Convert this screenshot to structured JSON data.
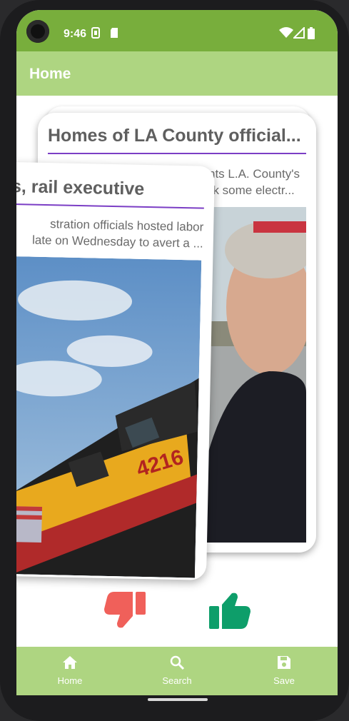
{
  "statusbar": {
    "time": "9:46"
  },
  "appbar": {
    "title": "Home"
  },
  "cards": [
    {
      "title": "Homes of LA County officials targeted",
      "title_visible": "Homes of LA County official...",
      "description_visible": "nts L.A. County's ok some electr..."
    },
    {
      "title_visible": "nions, rail executive...",
      "description_line1": "stration officials hosted labor",
      "description_line2": "late on Wednesday to avert a ...",
      "photo_number": "4216"
    }
  ],
  "actions": {
    "dislike": "thumbs-down",
    "like": "thumbs-up"
  },
  "nav": [
    {
      "label": "Home",
      "icon": "home-icon"
    },
    {
      "label": "Search",
      "icon": "search-icon"
    },
    {
      "label": "Save",
      "icon": "save-icon"
    }
  ],
  "colors": {
    "status": "#78ae3c",
    "appbar": "#aed581",
    "dislike": "#f0605a",
    "like": "#0e9e6a",
    "rule": "#7b3ec5"
  }
}
